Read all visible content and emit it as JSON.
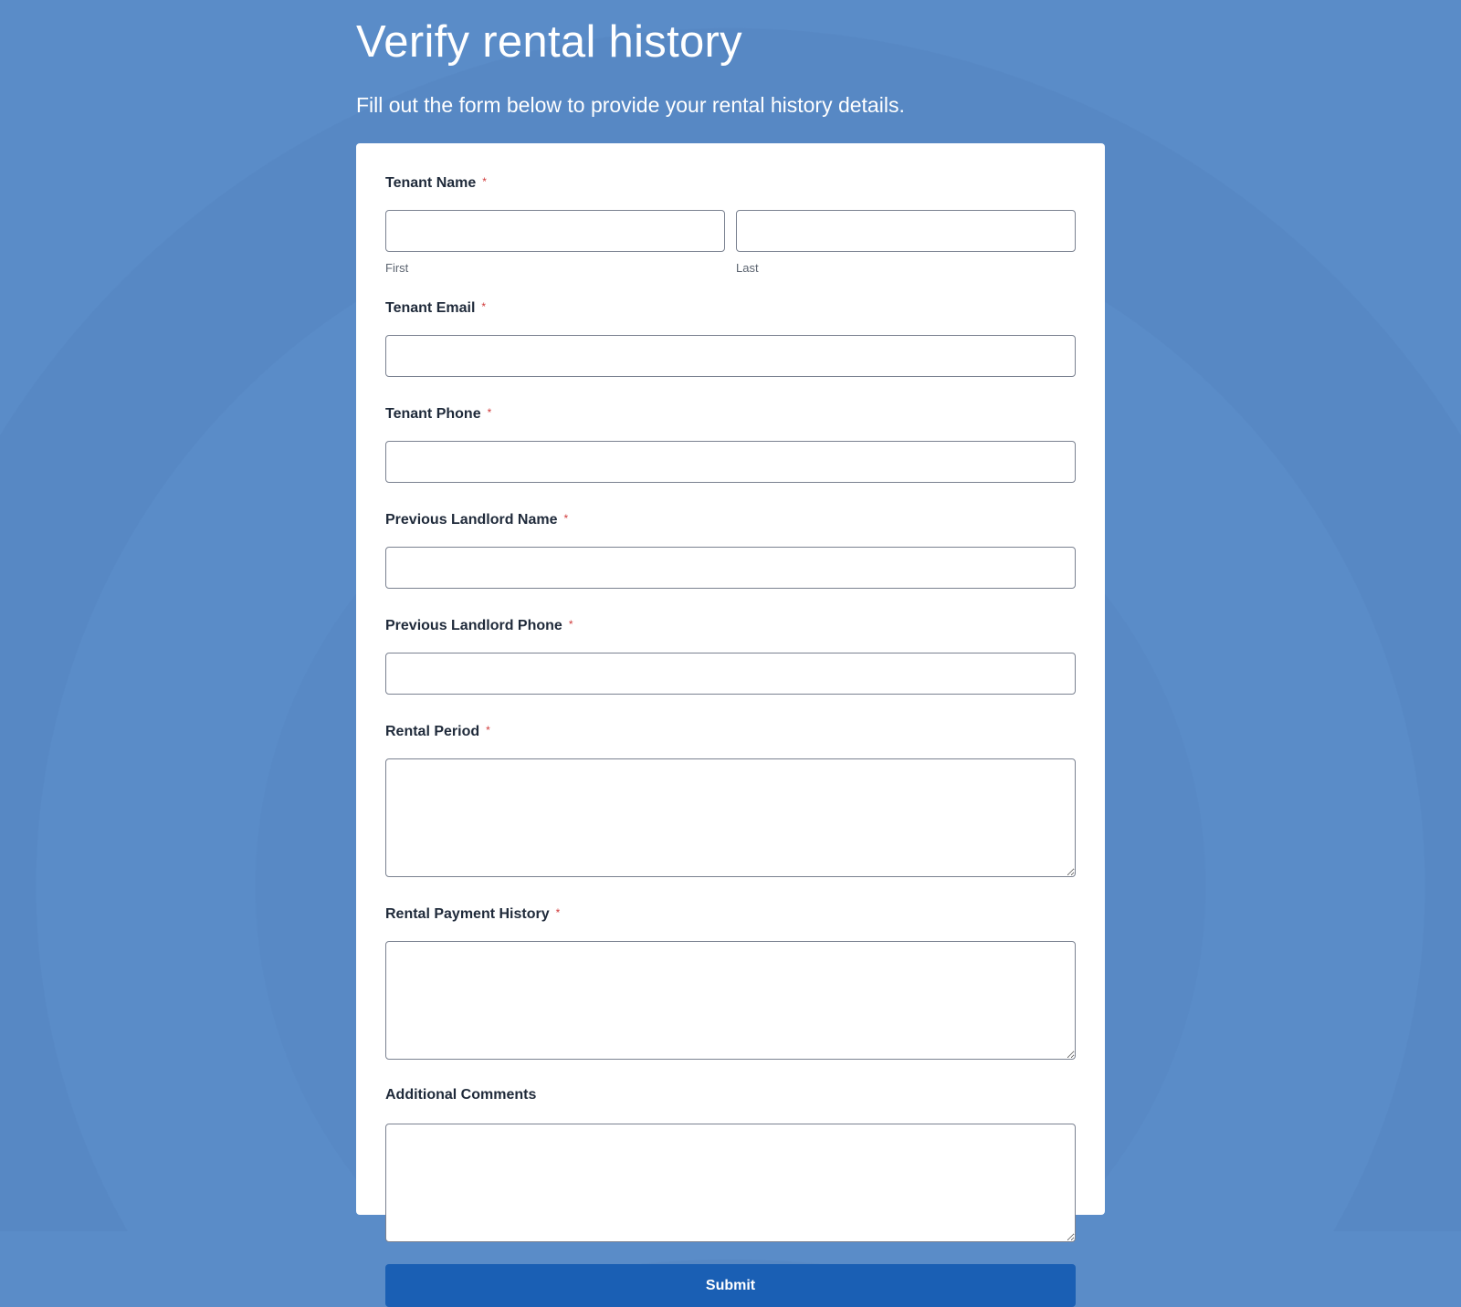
{
  "page": {
    "title": "Verify rental history",
    "subtitle": "Fill out the form below to provide your rental history details."
  },
  "colors": {
    "background": "#5a8cc8",
    "card": "#ffffff",
    "button": "#1a5fb4",
    "required_marker": "#d03a3a"
  },
  "form": {
    "required_marker": "*",
    "tenant_name": {
      "label": "Tenant Name",
      "required": true,
      "first": {
        "sublabel": "First",
        "value": ""
      },
      "last": {
        "sublabel": "Last",
        "value": ""
      }
    },
    "tenant_email": {
      "label": "Tenant Email",
      "required": true,
      "value": ""
    },
    "tenant_phone": {
      "label": "Tenant Phone",
      "required": true,
      "value": ""
    },
    "landlord_name": {
      "label": "Previous Landlord Name",
      "required": true,
      "value": ""
    },
    "landlord_phone": {
      "label": "Previous Landlord Phone",
      "required": true,
      "value": ""
    },
    "rental_period": {
      "label": "Rental Period",
      "required": true,
      "value": ""
    },
    "payment_history": {
      "label": "Rental Payment History",
      "required": true,
      "value": ""
    },
    "comments": {
      "label": "Additional Comments",
      "required": false,
      "value": ""
    },
    "submit_label": "Submit"
  }
}
